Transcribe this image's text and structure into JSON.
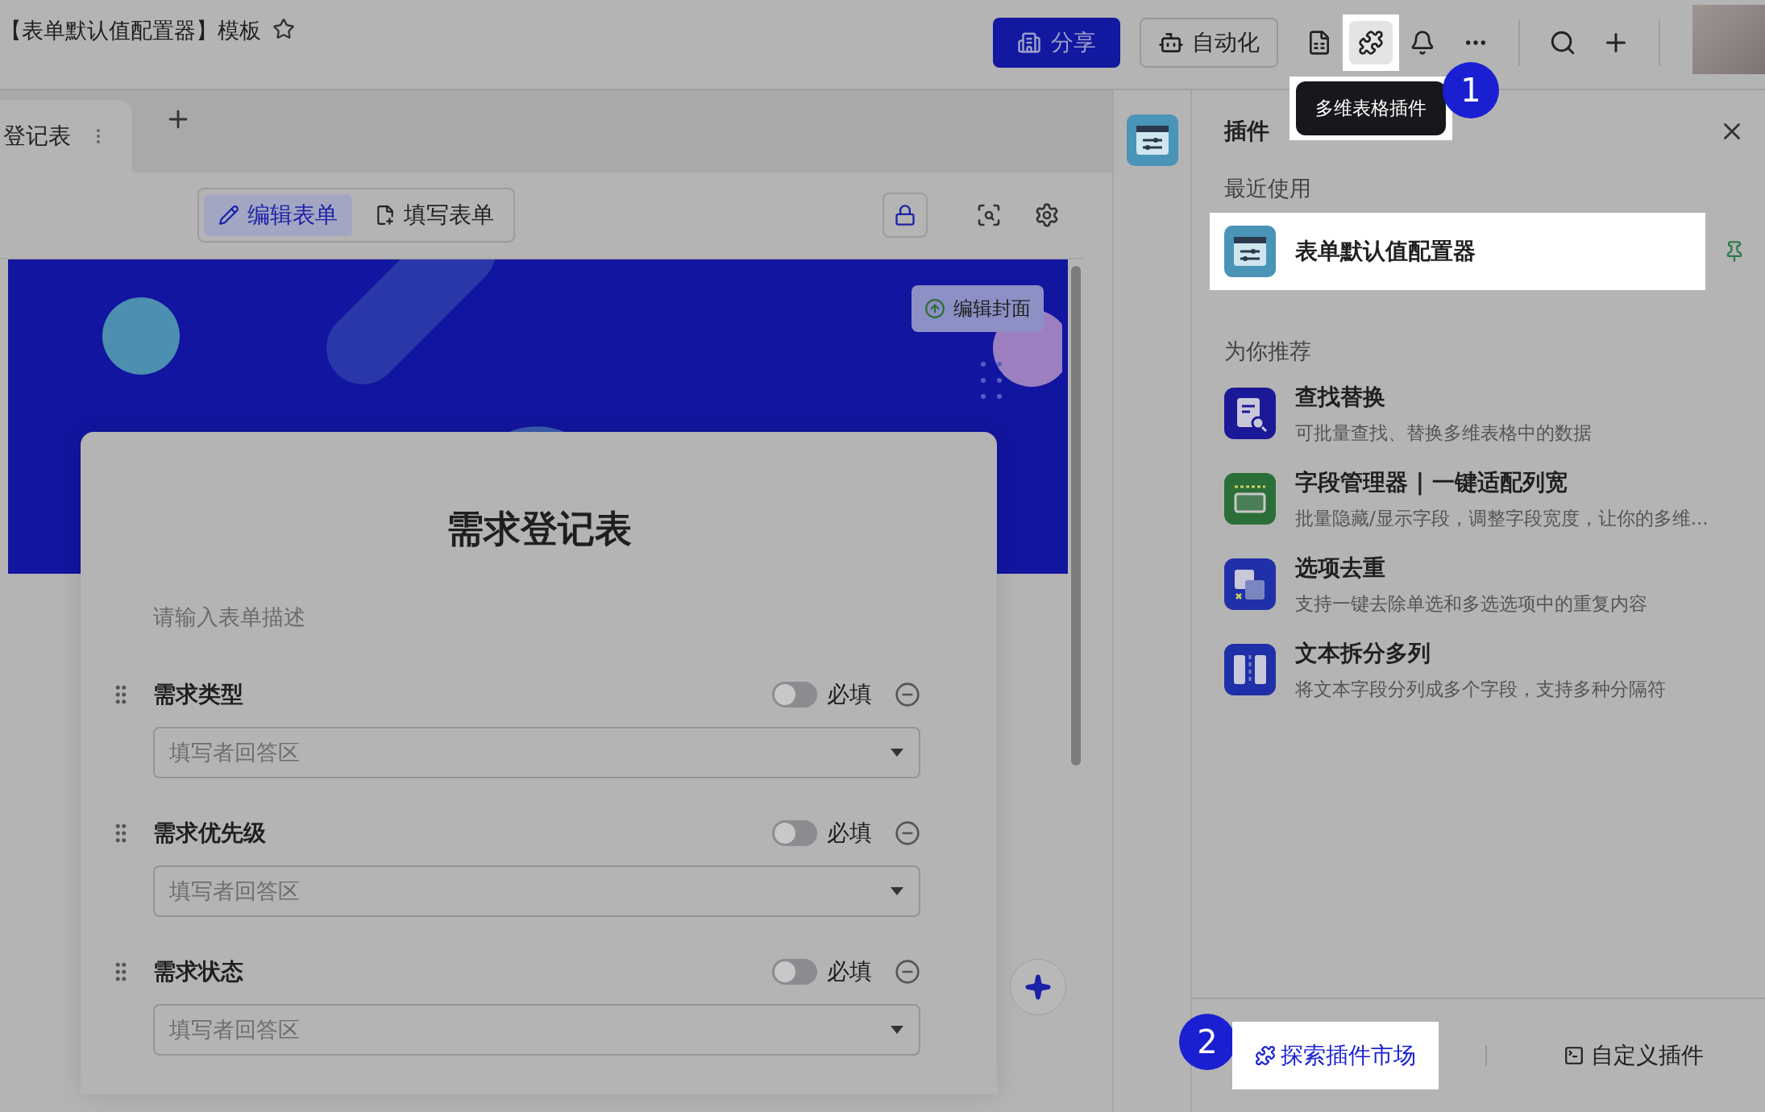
{
  "header": {
    "title": "【表单默认值配置器】模板",
    "share_button": "分享",
    "automation_button": "自动化"
  },
  "guide": {
    "tooltip": "多维表格插件",
    "step_one": "1",
    "step_two": "2"
  },
  "sheet_tabs": [
    {
      "label": "登记表",
      "selected": true
    }
  ],
  "form_modes": [
    {
      "label": "编辑表单",
      "selected": true
    },
    {
      "label": "填写表单",
      "selected": false
    }
  ],
  "form": {
    "cover_button": "编辑封面",
    "title": "需求登记表",
    "description_placeholder": "请输入表单描述",
    "fields": [
      {
        "label": "需求类型",
        "required_label": "必填",
        "required": false,
        "placeholder": "填写者回答区"
      },
      {
        "label": "需求优先级",
        "required_label": "必填",
        "required": false,
        "placeholder": "填写者回答区"
      },
      {
        "label": "需求状态",
        "required_label": "必填",
        "required": false,
        "placeholder": "填写者回答区"
      }
    ]
  },
  "plugin_panel": {
    "title": "插件",
    "recent_heading": "最近使用",
    "recent": [
      {
        "name": "表单默认值配置器",
        "kind": "sliders"
      }
    ],
    "recommended_heading": "为你推荐",
    "recommended": [
      {
        "name": "查找替换",
        "description": "可批量查找、替换多维表格中的数据",
        "kind": "search"
      },
      {
        "name": "字段管理器 | 一键适配列宽",
        "description": "批量隐藏/显示字段，调整字段宽度，让你的多维...",
        "kind": "columns"
      },
      {
        "name": "选项去重",
        "description": "支持一键去除单选和多选选项中的重复内容",
        "kind": "dedupe"
      },
      {
        "name": "文本拆分多列",
        "description": "将文本字段分列成多个字段，支持多种分隔符",
        "kind": "split"
      }
    ],
    "explore_button": "探索插件市场",
    "custom_button": "自定义插件"
  }
}
